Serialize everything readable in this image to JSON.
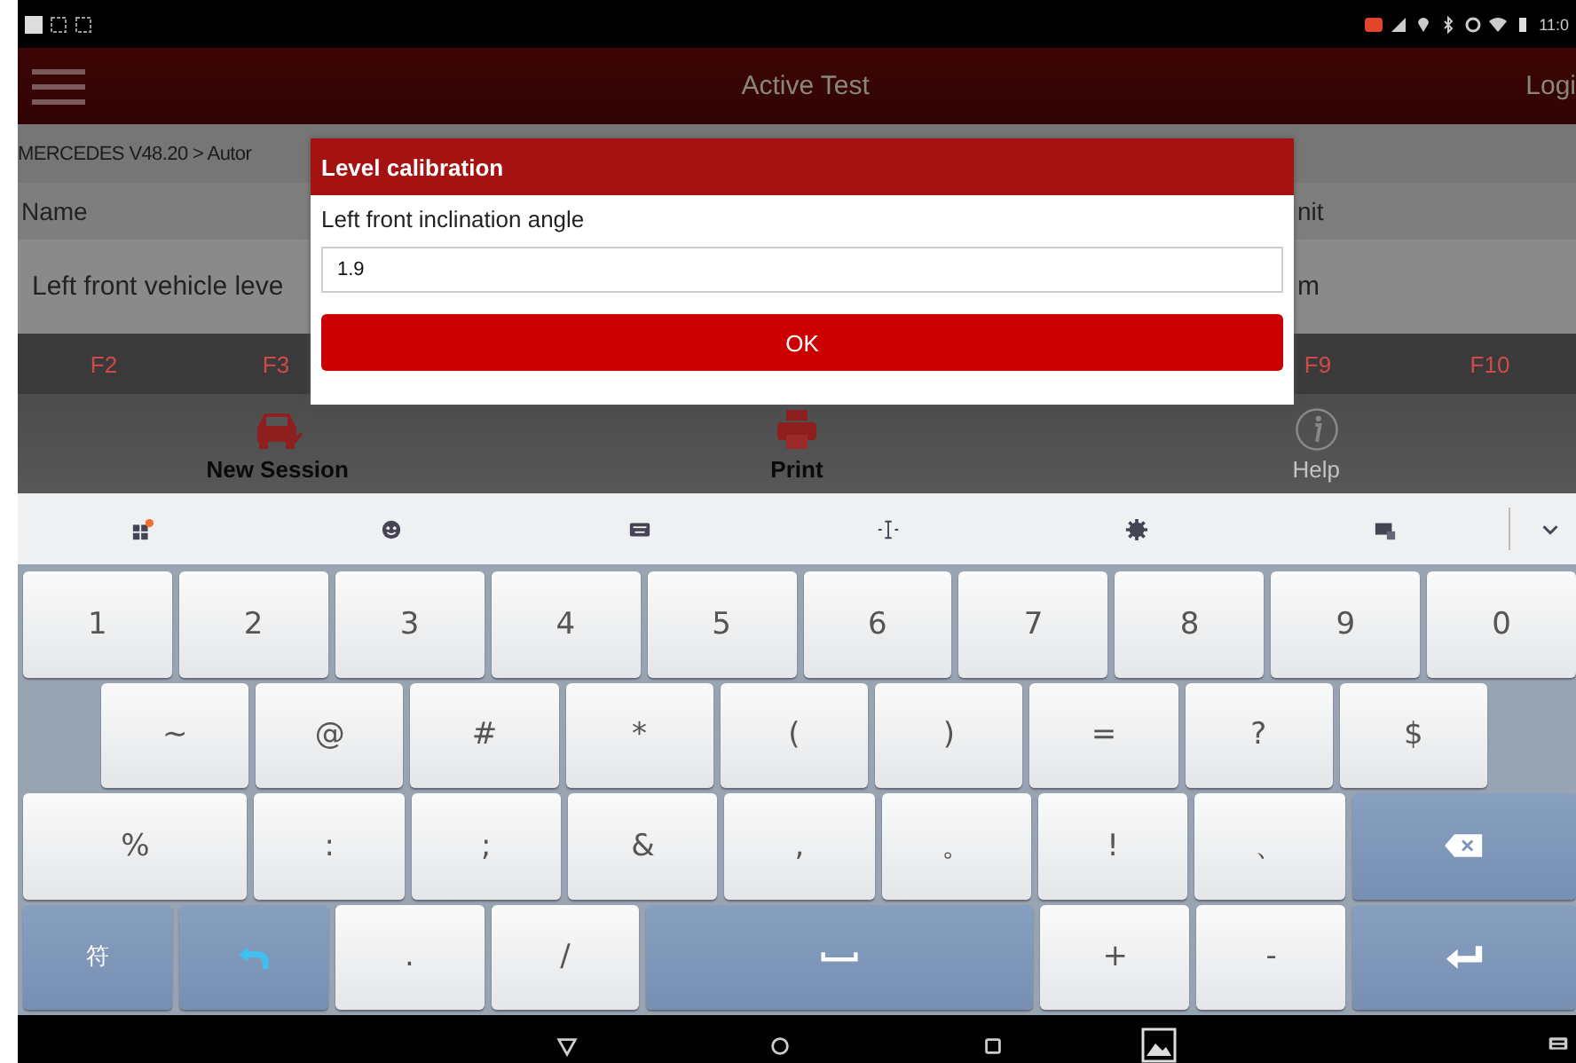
{
  "status_bar": {
    "time": "11:0"
  },
  "app_bar": {
    "title": "Active Test",
    "action": "Logi"
  },
  "breadcrumb": "MERCEDES V48.20 > Autor",
  "table": {
    "columns": [
      "Name",
      "nit"
    ],
    "rows": [
      [
        "Left front vehicle leve",
        "m"
      ]
    ]
  },
  "function_keys_left": [
    "F2",
    "F3"
  ],
  "function_keys_right": [
    "F9",
    "F10"
  ],
  "toolbar": [
    {
      "kind": "car",
      "label": "New Session",
      "disabled": false
    },
    {
      "kind": "printer",
      "label": "Print",
      "disabled": false
    },
    {
      "kind": "info",
      "label": "Help",
      "disabled": true
    }
  ],
  "dialog": {
    "title": "Level calibration",
    "label": "Left front inclination angle",
    "value": "1.9",
    "button": "OK"
  },
  "keyboard": {
    "rows": [
      [
        {
          "kind": "char",
          "label": "1"
        },
        {
          "kind": "char",
          "label": "2"
        },
        {
          "kind": "char",
          "label": "3"
        },
        {
          "kind": "char",
          "label": "4"
        },
        {
          "kind": "char",
          "label": "5"
        },
        {
          "kind": "char",
          "label": "6"
        },
        {
          "kind": "char",
          "label": "7"
        },
        {
          "kind": "char",
          "label": "8"
        },
        {
          "kind": "char",
          "label": "9"
        },
        {
          "kind": "char",
          "label": "0"
        }
      ],
      [
        {
          "kind": "char",
          "label": "~"
        },
        {
          "kind": "char",
          "label": "@"
        },
        {
          "kind": "char",
          "label": "#"
        },
        {
          "kind": "char",
          "label": "*"
        },
        {
          "kind": "char",
          "label": "("
        },
        {
          "kind": "char",
          "label": ")"
        },
        {
          "kind": "char",
          "label": "="
        },
        {
          "kind": "char",
          "label": "?"
        },
        {
          "kind": "char",
          "label": "$"
        }
      ],
      [
        {
          "kind": "char",
          "label": "%"
        },
        {
          "kind": "char",
          "label": ":"
        },
        {
          "kind": "char",
          "label": ";"
        },
        {
          "kind": "char",
          "label": "&"
        },
        {
          "kind": "char",
          "label": ","
        },
        {
          "kind": "char",
          "label": "。"
        },
        {
          "kind": "char",
          "label": "!"
        },
        {
          "kind": "char",
          "label": "、"
        },
        {
          "kind": "backspace"
        }
      ],
      [
        {
          "kind": "function",
          "label": "符"
        },
        {
          "kind": "undo"
        },
        {
          "kind": "char",
          "label": "."
        },
        {
          "kind": "char",
          "label": "/"
        },
        {
          "kind": "space"
        },
        {
          "kind": "char",
          "label": "+"
        },
        {
          "kind": "char",
          "label": "-"
        },
        {
          "kind": "enter"
        }
      ]
    ]
  }
}
